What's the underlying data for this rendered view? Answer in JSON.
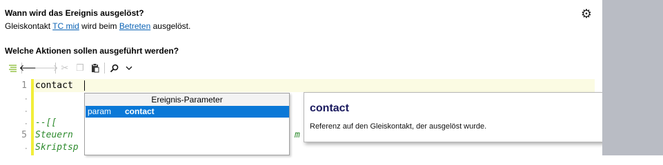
{
  "section1": {
    "heading": "Wann wird das Ereignis ausgelöst?",
    "sentence_prefix": "Gleiskontakt",
    "contact_link": "TC mid",
    "sentence_middle": "wird beim",
    "action_link": "Betreten",
    "sentence_suffix": "ausgelöst."
  },
  "section2": {
    "heading": "Welche Aktionen sollen ausgeführt werden?"
  },
  "toolbar": {
    "icons": [
      "format-lines-icon",
      "undo-icon",
      "redo-icon",
      "cut-icon",
      "copy-icon",
      "paste-icon",
      "search-icon",
      "chevron-down-icon"
    ],
    "disabled": [
      "redo-icon",
      "cut-icon",
      "copy-icon"
    ]
  },
  "editor": {
    "line_numbers": [
      "1",
      "5"
    ],
    "lines": {
      "line1": "contact",
      "line4": "--[[",
      "line5": "Steuern",
      "line5_tail": "m",
      "line6": "Skriptsp"
    }
  },
  "autocomplete": {
    "header": "Ereignis-Parameter",
    "item": {
      "kind": "param",
      "name": "contact"
    },
    "selected_color": "#0a78d7"
  },
  "tooltip": {
    "title": "contact",
    "description": "Referenz auf den Gleiskontakt, der ausgelöst wurde."
  },
  "colors": {
    "comment": "#2e8b2e",
    "link": "#0b63b5",
    "marker": "#f2ee3a"
  }
}
